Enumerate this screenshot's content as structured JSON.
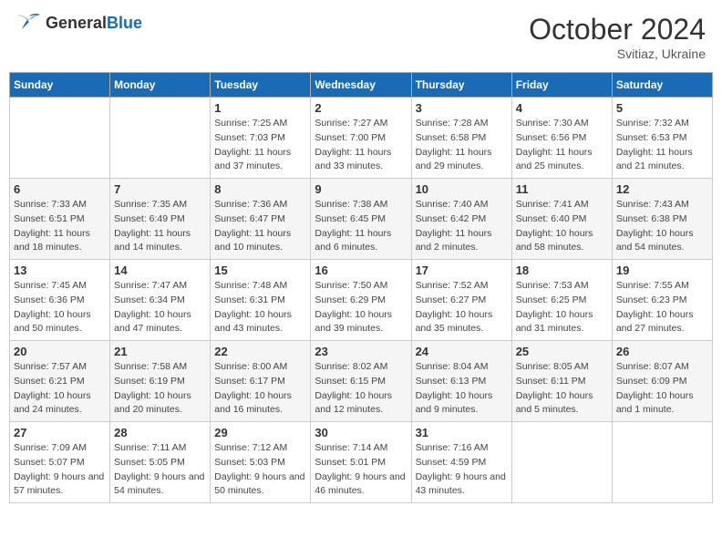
{
  "logo": {
    "general": "General",
    "blue": "Blue"
  },
  "title": "October 2024",
  "subtitle": "Svitiaz, Ukraine",
  "weekdays": [
    "Sunday",
    "Monday",
    "Tuesday",
    "Wednesday",
    "Thursday",
    "Friday",
    "Saturday"
  ],
  "weeks": [
    [
      {
        "day": "",
        "info": ""
      },
      {
        "day": "",
        "info": ""
      },
      {
        "day": "1",
        "info": "Sunrise: 7:25 AM\nSunset: 7:03 PM\nDaylight: 11 hours and 37 minutes."
      },
      {
        "day": "2",
        "info": "Sunrise: 7:27 AM\nSunset: 7:00 PM\nDaylight: 11 hours and 33 minutes."
      },
      {
        "day": "3",
        "info": "Sunrise: 7:28 AM\nSunset: 6:58 PM\nDaylight: 11 hours and 29 minutes."
      },
      {
        "day": "4",
        "info": "Sunrise: 7:30 AM\nSunset: 6:56 PM\nDaylight: 11 hours and 25 minutes."
      },
      {
        "day": "5",
        "info": "Sunrise: 7:32 AM\nSunset: 6:53 PM\nDaylight: 11 hours and 21 minutes."
      }
    ],
    [
      {
        "day": "6",
        "info": "Sunrise: 7:33 AM\nSunset: 6:51 PM\nDaylight: 11 hours and 18 minutes."
      },
      {
        "day": "7",
        "info": "Sunrise: 7:35 AM\nSunset: 6:49 PM\nDaylight: 11 hours and 14 minutes."
      },
      {
        "day": "8",
        "info": "Sunrise: 7:36 AM\nSunset: 6:47 PM\nDaylight: 11 hours and 10 minutes."
      },
      {
        "day": "9",
        "info": "Sunrise: 7:38 AM\nSunset: 6:45 PM\nDaylight: 11 hours and 6 minutes."
      },
      {
        "day": "10",
        "info": "Sunrise: 7:40 AM\nSunset: 6:42 PM\nDaylight: 11 hours and 2 minutes."
      },
      {
        "day": "11",
        "info": "Sunrise: 7:41 AM\nSunset: 6:40 PM\nDaylight: 10 hours and 58 minutes."
      },
      {
        "day": "12",
        "info": "Sunrise: 7:43 AM\nSunset: 6:38 PM\nDaylight: 10 hours and 54 minutes."
      }
    ],
    [
      {
        "day": "13",
        "info": "Sunrise: 7:45 AM\nSunset: 6:36 PM\nDaylight: 10 hours and 50 minutes."
      },
      {
        "day": "14",
        "info": "Sunrise: 7:47 AM\nSunset: 6:34 PM\nDaylight: 10 hours and 47 minutes."
      },
      {
        "day": "15",
        "info": "Sunrise: 7:48 AM\nSunset: 6:31 PM\nDaylight: 10 hours and 43 minutes."
      },
      {
        "day": "16",
        "info": "Sunrise: 7:50 AM\nSunset: 6:29 PM\nDaylight: 10 hours and 39 minutes."
      },
      {
        "day": "17",
        "info": "Sunrise: 7:52 AM\nSunset: 6:27 PM\nDaylight: 10 hours and 35 minutes."
      },
      {
        "day": "18",
        "info": "Sunrise: 7:53 AM\nSunset: 6:25 PM\nDaylight: 10 hours and 31 minutes."
      },
      {
        "day": "19",
        "info": "Sunrise: 7:55 AM\nSunset: 6:23 PM\nDaylight: 10 hours and 27 minutes."
      }
    ],
    [
      {
        "day": "20",
        "info": "Sunrise: 7:57 AM\nSunset: 6:21 PM\nDaylight: 10 hours and 24 minutes."
      },
      {
        "day": "21",
        "info": "Sunrise: 7:58 AM\nSunset: 6:19 PM\nDaylight: 10 hours and 20 minutes."
      },
      {
        "day": "22",
        "info": "Sunrise: 8:00 AM\nSunset: 6:17 PM\nDaylight: 10 hours and 16 minutes."
      },
      {
        "day": "23",
        "info": "Sunrise: 8:02 AM\nSunset: 6:15 PM\nDaylight: 10 hours and 12 minutes."
      },
      {
        "day": "24",
        "info": "Sunrise: 8:04 AM\nSunset: 6:13 PM\nDaylight: 10 hours and 9 minutes."
      },
      {
        "day": "25",
        "info": "Sunrise: 8:05 AM\nSunset: 6:11 PM\nDaylight: 10 hours and 5 minutes."
      },
      {
        "day": "26",
        "info": "Sunrise: 8:07 AM\nSunset: 6:09 PM\nDaylight: 10 hours and 1 minute."
      }
    ],
    [
      {
        "day": "27",
        "info": "Sunrise: 7:09 AM\nSunset: 5:07 PM\nDaylight: 9 hours and 57 minutes."
      },
      {
        "day": "28",
        "info": "Sunrise: 7:11 AM\nSunset: 5:05 PM\nDaylight: 9 hours and 54 minutes."
      },
      {
        "day": "29",
        "info": "Sunrise: 7:12 AM\nSunset: 5:03 PM\nDaylight: 9 hours and 50 minutes."
      },
      {
        "day": "30",
        "info": "Sunrise: 7:14 AM\nSunset: 5:01 PM\nDaylight: 9 hours and 46 minutes."
      },
      {
        "day": "31",
        "info": "Sunrise: 7:16 AM\nSunset: 4:59 PM\nDaylight: 9 hours and 43 minutes."
      },
      {
        "day": "",
        "info": ""
      },
      {
        "day": "",
        "info": ""
      }
    ]
  ]
}
